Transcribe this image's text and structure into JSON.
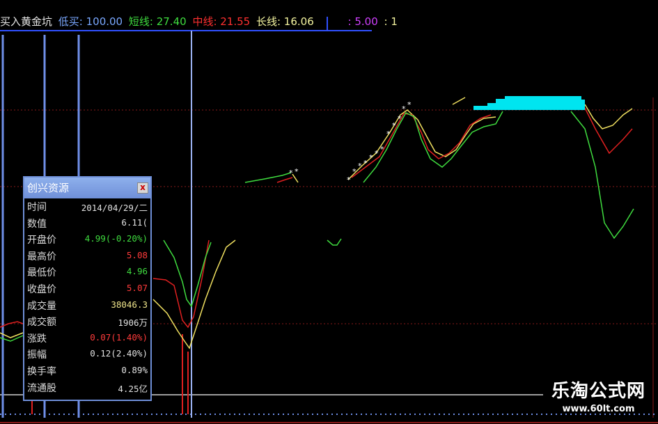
{
  "header": {
    "title": "买入黄金坑",
    "low_buy": "低买: 100.00",
    "short_line": "短线: 27.40",
    "mid_line": "中线: 21.55",
    "long_line": "长线: 16.06",
    "extra": ": 5.00",
    "extra2": ": 1"
  },
  "panel": {
    "title": "创兴资源",
    "close": "x",
    "rows": [
      {
        "label": "时间",
        "value": "2014/04/29/二"
      },
      {
        "label": "数值",
        "value": "6.11("
      },
      {
        "label": "开盘价",
        "value": "4.99(-0.20%)"
      },
      {
        "label": "最高价",
        "value": "5.08"
      },
      {
        "label": "最低价",
        "value": "4.96"
      },
      {
        "label": "收盘价",
        "value": "5.07"
      },
      {
        "label": "成交量",
        "value": "38046.3"
      },
      {
        "label": "成交额",
        "value": "1906万"
      },
      {
        "label": "涨跌",
        "value": "0.07(1.40%)"
      },
      {
        "label": "振幅",
        "value": "0.12(2.40%)"
      },
      {
        "label": "换手率",
        "value": "0.89%"
      },
      {
        "label": "流通股",
        "value": "4.25亿"
      }
    ]
  },
  "watermark": {
    "cn": "乐淘公式网",
    "url": "www.60lt.com"
  },
  "colors": {
    "short": "#3fdc3f",
    "mid": "#e02020",
    "long": "#f0e060",
    "low_buy": "#7aa8ff",
    "band": "#00e5f0"
  }
}
